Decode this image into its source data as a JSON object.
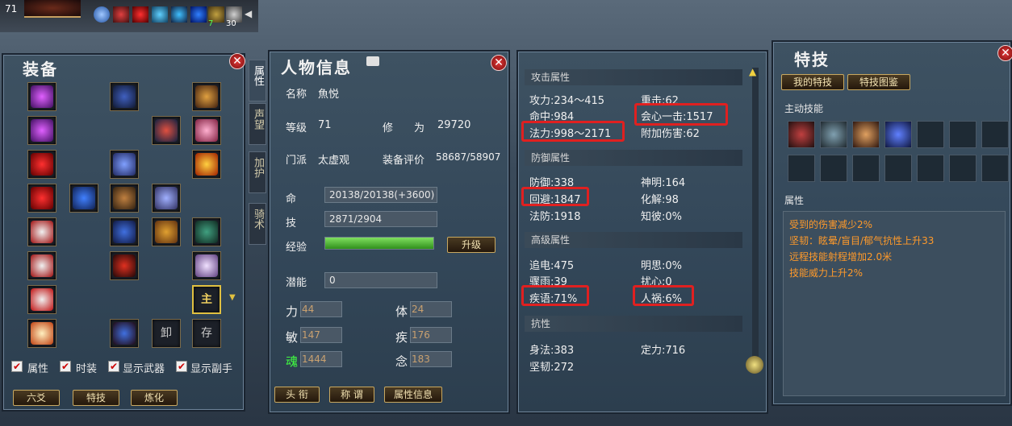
{
  "topbar": {
    "level": "71",
    "buff_counts": [
      "7",
      "30"
    ]
  },
  "equip": {
    "title": "装备",
    "slot_labels": {
      "main": "主",
      "unload": "卸",
      "store": "存"
    },
    "checkboxes": [
      "属性",
      "时装",
      "显示武器",
      "显示副手"
    ],
    "buttons": [
      "六爻",
      "特技",
      "炼化"
    ]
  },
  "tabs": [
    "属性",
    "声望",
    "加护",
    "骑术"
  ],
  "char": {
    "title": "人物信息",
    "name_label": "名称",
    "name": "魚悦",
    "level_label": "等级",
    "level": "71",
    "cultivation_label": "修　　为",
    "cultivation": "29720",
    "school_label": "门派",
    "school": "太虚观",
    "rating_label": "装备评价",
    "rating": "58687/58907",
    "hp_label": "命",
    "hp": "20138/20138(+3600)",
    "mp_label": "技",
    "mp": "2871/2904",
    "exp_label": "经验",
    "exp_fraction": 1.0,
    "upgrade": "升级",
    "potential_label": "潜能",
    "potential": "0",
    "attrs": [
      {
        "label": "力",
        "value": "44"
      },
      {
        "label": "体",
        "value": "24"
      },
      {
        "label": "敏",
        "value": "147"
      },
      {
        "label": "疾",
        "value": "176"
      },
      {
        "label": "魂",
        "value": "1444"
      },
      {
        "label": "念",
        "value": "183"
      }
    ],
    "buttons": [
      "头 衔",
      "称 谓",
      "属性信息"
    ]
  },
  "stats": {
    "sections": [
      {
        "header": "攻击属性",
        "rows": [
          [
            "攻力:234～415",
            "重击:62"
          ],
          [
            "命中:984",
            "会心一击:1517"
          ],
          [
            "法力:998～2171",
            "附加伤害:62"
          ]
        ]
      },
      {
        "header": "防御属性",
        "rows": [
          [
            "防御:338",
            "神明:164"
          ],
          [
            "回避:1847",
            "化解:98"
          ],
          [
            "法防:1918",
            "知彼:0%"
          ]
        ]
      },
      {
        "header": "高级属性",
        "rows": [
          [
            "追电:475",
            "明思:0%"
          ],
          [
            "骤雨:39",
            "扰心:0"
          ],
          [
            "疾语:71%",
            "人祸:6%"
          ]
        ]
      },
      {
        "header": "抗性",
        "rows": [
          [
            "身法:383",
            "定力:716"
          ],
          [
            "坚韧:272",
            ""
          ]
        ]
      }
    ]
  },
  "skills": {
    "title": "特技",
    "tabs": [
      "我的特技",
      "特技图鉴"
    ],
    "active_label": "主动技能",
    "attr_label": "属性",
    "effects": [
      "受到的伤害减少2%",
      "坚韧：眩晕/盲目/郁气抗性上升33",
      "远程技能射程增加2.0米",
      "技能威力上升2%"
    ],
    "accent_color": "#ff9a2a"
  }
}
